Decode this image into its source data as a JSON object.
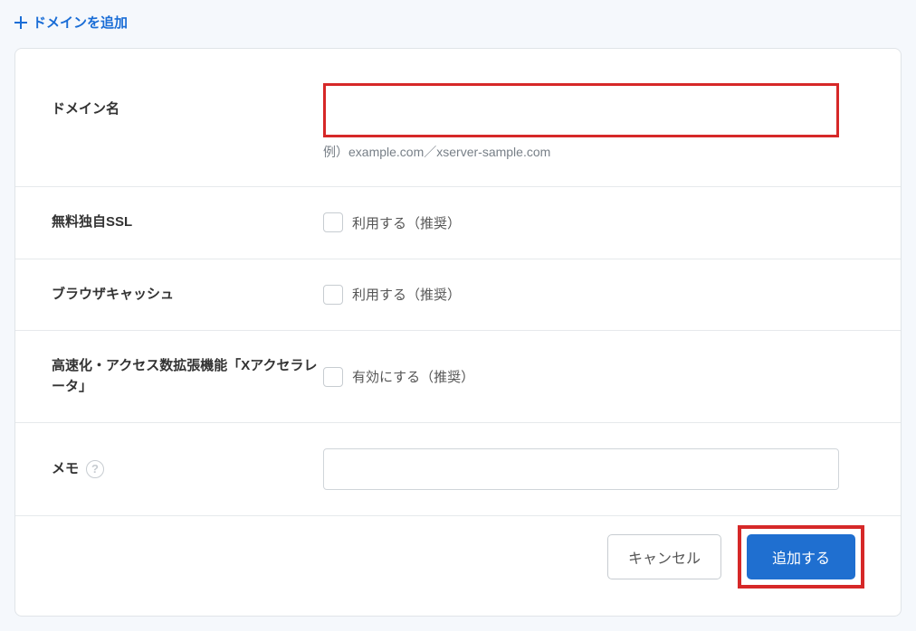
{
  "header": {
    "add_domain_label": "ドメインを追加"
  },
  "form": {
    "domain": {
      "label": "ドメイン名",
      "value": "",
      "hint": "例）example.com／xserver-sample.com"
    },
    "ssl": {
      "label": "無料独自SSL",
      "checkbox_label": "利用する（推奨）"
    },
    "browser_cache": {
      "label": "ブラウザキャッシュ",
      "checkbox_label": "利用する（推奨）"
    },
    "xaccelerator": {
      "label": "高速化・アクセス数拡張機能「Xアクセラレータ」",
      "checkbox_label": "有効にする（推奨）"
    },
    "memo": {
      "label": "メモ",
      "value": ""
    }
  },
  "buttons": {
    "cancel": "キャンセル",
    "submit": "追加する"
  }
}
